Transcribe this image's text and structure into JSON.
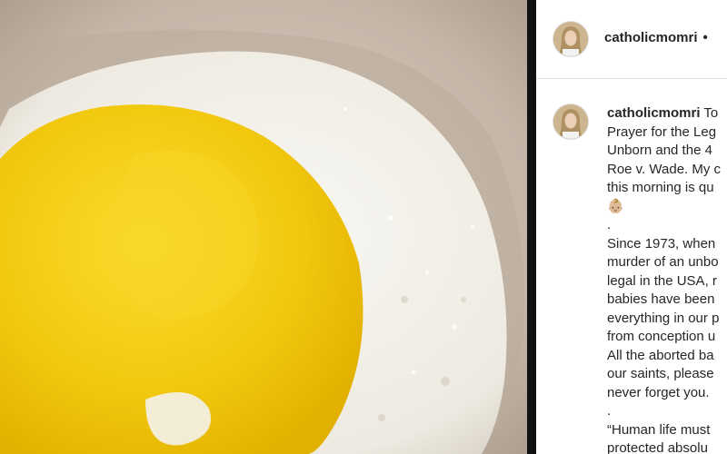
{
  "post": {
    "username": "catholicmomri",
    "header_separator": "•",
    "caption_lines": [
      {
        "user": "catholicmomri",
        "text": " To"
      },
      {
        "text": "Prayer for the Leg"
      },
      {
        "text": "Unborn and the 4"
      },
      {
        "text": "Roe v. Wade. My c"
      },
      {
        "text": "this morning is qu"
      },
      {
        "text": "👶🏼"
      },
      {
        "text": "."
      },
      {
        "text": "Since 1973, when"
      },
      {
        "text": "murder of an unbo"
      },
      {
        "text": "legal in the USA, r"
      },
      {
        "text": "babies have been"
      },
      {
        "text": "everything in our p"
      },
      {
        "text": "from conception u"
      },
      {
        "text": "All the aborted ba"
      },
      {
        "text": "our saints, please"
      },
      {
        "text": "never forget you."
      },
      {
        "text": "."
      },
      {
        "text": "“Human life must"
      },
      {
        "text": "protected absolu"
      }
    ]
  },
  "colors": {
    "text": "#262626",
    "yolk": "#f4c912",
    "egg_white": "#f4f2ec",
    "pan": "#c7b9aa"
  },
  "icons": {
    "header_avatar": "profile-photo",
    "caption_avatar": "profile-photo"
  }
}
